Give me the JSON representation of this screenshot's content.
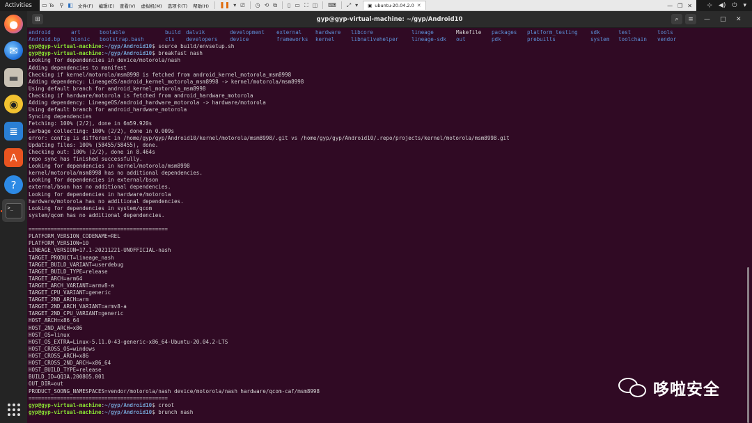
{
  "topbar": {
    "activities": "Activities"
  },
  "vmware": {
    "menus": [
      "文件(F)",
      "编辑(E)",
      "查看(V)",
      "虚拟机(M)",
      "选项卡(T)",
      "帮助(H)"
    ],
    "partial_tab": "Te",
    "tab_label": "ubuntu-20.04.2.0"
  },
  "terminal": {
    "title": "gyp@gyp-virtual-machine: ~/gyp/Android10",
    "ls_rows": [
      [
        {
          "t": "android",
          "k": "dir"
        },
        {
          "t": "art",
          "k": "dir"
        },
        {
          "t": "bootable",
          "k": "dir"
        },
        {
          "t": "build",
          "k": "dir"
        },
        {
          "t": "dalvik",
          "k": "dir"
        },
        {
          "t": "development",
          "k": "dir"
        },
        {
          "t": "external",
          "k": "dir"
        },
        {
          "t": "hardware",
          "k": "dir"
        },
        {
          "t": "libcore",
          "k": "dir"
        },
        {
          "t": "lineage",
          "k": "dir"
        },
        {
          "t": "Makefile",
          "k": "file"
        },
        {
          "t": "packages",
          "k": "dir"
        },
        {
          "t": "platform_testing",
          "k": "dir"
        },
        {
          "t": "sdk",
          "k": "dir"
        },
        {
          "t": "test",
          "k": "dir"
        },
        {
          "t": "tools",
          "k": "dir"
        }
      ],
      [
        {
          "t": "Android.bp",
          "k": "dir"
        },
        {
          "t": "bionic",
          "k": "dir"
        },
        {
          "t": "bootstrap.bash",
          "k": "dir"
        },
        {
          "t": "cts",
          "k": "dir"
        },
        {
          "t": "developers",
          "k": "dir"
        },
        {
          "t": "device",
          "k": "dir"
        },
        {
          "t": "frameworks",
          "k": "dir"
        },
        {
          "t": "kernel",
          "k": "dir"
        },
        {
          "t": "libnativehelper",
          "k": "dir"
        },
        {
          "t": "lineage-sdk",
          "k": "dir"
        },
        {
          "t": "out",
          "k": "dir"
        },
        {
          "t": "pdk",
          "k": "dir"
        },
        {
          "t": "prebuilts",
          "k": "dir"
        },
        {
          "t": "system",
          "k": "dir"
        },
        {
          "t": "toolchain",
          "k": "dir"
        },
        {
          "t": "vendor",
          "k": "dir"
        }
      ]
    ],
    "lines": [
      {
        "user": "gyp@gyp-virtual-machine",
        "path": "~/gyp/Android10",
        "cmd": "$ source build/envsetup.sh"
      },
      {
        "user": "gyp@gyp-virtual-machine",
        "path": "~/gyp/Android10",
        "cmd": "$ breakfast nash"
      },
      {
        "text": "Looking for dependencies in device/motorola/nash"
      },
      {
        "text": "Adding dependencies to manifest"
      },
      {
        "text": "Checking if kernel/motorola/msm8998 is fetched from android_kernel_motorola_msm8998"
      },
      {
        "text": "Adding dependency: LineageOS/android_kernel_motorola_msm8998 -> kernel/motorola/msm8998"
      },
      {
        "text": "Using default branch for android_kernel_motorola_msm8998"
      },
      {
        "text": "Checking if hardware/motorola is fetched from android_hardware_motorola"
      },
      {
        "text": "Adding dependency: LineageOS/android_hardware_motorola -> hardware/motorola"
      },
      {
        "text": "Using default branch for android_hardware_motorola"
      },
      {
        "text": "Syncing dependencies"
      },
      {
        "text": "Fetching: 100% (2/2), done in 6m59.920s"
      },
      {
        "text": "Garbage collecting: 100% (2/2), done in 0.009s"
      },
      {
        "text": "error: config is different in /home/gyp/gyp/Android10/kernel/motorola/msm8998/.git vs /home/gyp/gyp/Android10/.repo/projects/kernel/motorola/msm8998.git"
      },
      {
        "text": "Updating files: 100% (58455/58455), done."
      },
      {
        "text": "Checking out: 100% (2/2), done in 8.464s"
      },
      {
        "text": "repo sync has finished successfully."
      },
      {
        "text": "Looking for dependencies in kernel/motorola/msm8998"
      },
      {
        "text": "kernel/motorola/msm8998 has no additional dependencies."
      },
      {
        "text": "Looking for dependencies in external/bson"
      },
      {
        "text": "external/bson has no additional dependencies."
      },
      {
        "text": "Looking for dependencies in hardware/motorola"
      },
      {
        "text": "hardware/motorola has no additional dependencies."
      },
      {
        "text": "Looking for dependencies in system/qcom"
      },
      {
        "text": "system/qcom has no additional dependencies."
      },
      {
        "text": ""
      },
      {
        "text": "============================================"
      },
      {
        "text": "PLATFORM_VERSION_CODENAME=REL"
      },
      {
        "text": "PLATFORM_VERSION=10"
      },
      {
        "text": "LINEAGE_VERSION=17.1-20211221-UNOFFICIAL-nash"
      },
      {
        "text": "TARGET_PRODUCT=lineage_nash"
      },
      {
        "text": "TARGET_BUILD_VARIANT=userdebug"
      },
      {
        "text": "TARGET_BUILD_TYPE=release"
      },
      {
        "text": "TARGET_ARCH=arm64"
      },
      {
        "text": "TARGET_ARCH_VARIANT=armv8-a"
      },
      {
        "text": "TARGET_CPU_VARIANT=generic"
      },
      {
        "text": "TARGET_2ND_ARCH=arm"
      },
      {
        "text": "TARGET_2ND_ARCH_VARIANT=armv8-a"
      },
      {
        "text": "TARGET_2ND_CPU_VARIANT=generic"
      },
      {
        "text": "HOST_ARCH=x86_64"
      },
      {
        "text": "HOST_2ND_ARCH=x86"
      },
      {
        "text": "HOST_OS=linux"
      },
      {
        "text": "HOST_OS_EXTRA=Linux-5.11.0-43-generic-x86_64-Ubuntu-20.04.2-LTS"
      },
      {
        "text": "HOST_CROSS_OS=windows"
      },
      {
        "text": "HOST_CROSS_ARCH=x86"
      },
      {
        "text": "HOST_CROSS_2ND_ARCH=x86_64"
      },
      {
        "text": "HOST_BUILD_TYPE=release"
      },
      {
        "text": "BUILD_ID=QQ3A.200805.001"
      },
      {
        "text": "OUT_DIR=out"
      },
      {
        "text": "PRODUCT_SOONG_NAMESPACES=vendor/motorola/nash device/motorola/nash hardware/qcom-caf/msm8998"
      },
      {
        "text": "============================================"
      },
      {
        "user": "gyp@gyp-virtual-machine",
        "path": "~/gyp/Android10",
        "cmd": "$ croot"
      },
      {
        "user": "gyp@gyp-virtual-machine",
        "path": "~/gyp/Android10",
        "cmd": "$ brunch nash"
      }
    ]
  },
  "watermark": {
    "text": "哆啦安全"
  },
  "colors": {
    "terminal_bg": "#300a24",
    "prompt_user": "#8ae234",
    "prompt_path": "#729fcf",
    "dir": "#5c8fd6",
    "accent": "#e95420"
  }
}
